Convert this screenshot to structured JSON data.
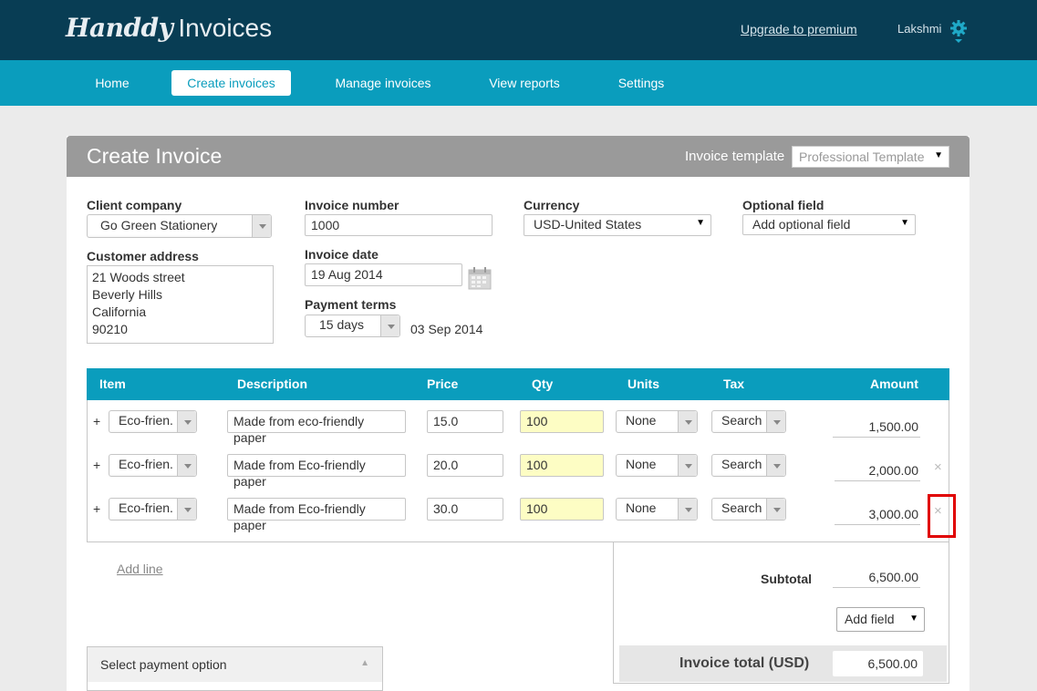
{
  "header": {
    "logo_script": "Handdy",
    "logo_plain": "Invoices",
    "upgrade_link": "Upgrade to premium",
    "username": "Lakshmi"
  },
  "nav": {
    "home": "Home",
    "create": "Create invoices",
    "manage": "Manage invoices",
    "reports": "View reports",
    "settings": "Settings"
  },
  "panel": {
    "title": "Create Invoice",
    "template_label": "Invoice template",
    "template_value": "Professional Template"
  },
  "form": {
    "client_company_label": "Client company",
    "client_company_value": "Go Green Stationery",
    "customer_address_label": "Customer address",
    "customer_address_value": "21 Woods street\nBeverly Hills\nCalifornia\n90210",
    "invoice_number_label": "Invoice number",
    "invoice_number_value": "1000",
    "invoice_date_label": "Invoice date",
    "invoice_date_value": "19 Aug 2014",
    "payment_terms_label": "Payment terms",
    "payment_terms_value": "15 days",
    "due_date": "03 Sep 2014",
    "currency_label": "Currency",
    "currency_value": "USD-United States",
    "optional_label": "Optional field",
    "optional_value": "Add optional field"
  },
  "table": {
    "headers": {
      "item": "Item",
      "description": "Description",
      "price": "Price",
      "qty": "Qty",
      "units": "Units",
      "tax": "Tax",
      "amount": "Amount"
    },
    "plus": "+",
    "remove": "×",
    "rows": [
      {
        "item": "Eco-frien.",
        "description": "Made from eco-friendly paper",
        "price": "15.0",
        "qty": "100",
        "units": "None",
        "tax": "Search",
        "amount": "1,500.00"
      },
      {
        "item": "Eco-frien.",
        "description": "Made from Eco-friendly paper",
        "price": "20.0",
        "qty": "100",
        "units": "None",
        "tax": "Search",
        "amount": "2,000.00"
      },
      {
        "item": "Eco-frien.",
        "description": "Made from Eco-friendly paper",
        "price": "30.0",
        "qty": "100",
        "units": "None",
        "tax": "Search",
        "amount": "3,000.00"
      }
    ]
  },
  "add_line": "Add line",
  "totals": {
    "subtotal_label": "Subtotal",
    "subtotal_value": "6,500.00",
    "add_field": "Add field",
    "total_label": "Invoice total (USD)",
    "total_value": "6,500.00"
  },
  "payment": {
    "label": "Select payment option"
  },
  "colors": {
    "header_dark": "#083d54",
    "nav_teal": "#0a9dbd",
    "qty_highlight": "#fdfdc4",
    "annotation_red": "#e00000"
  }
}
